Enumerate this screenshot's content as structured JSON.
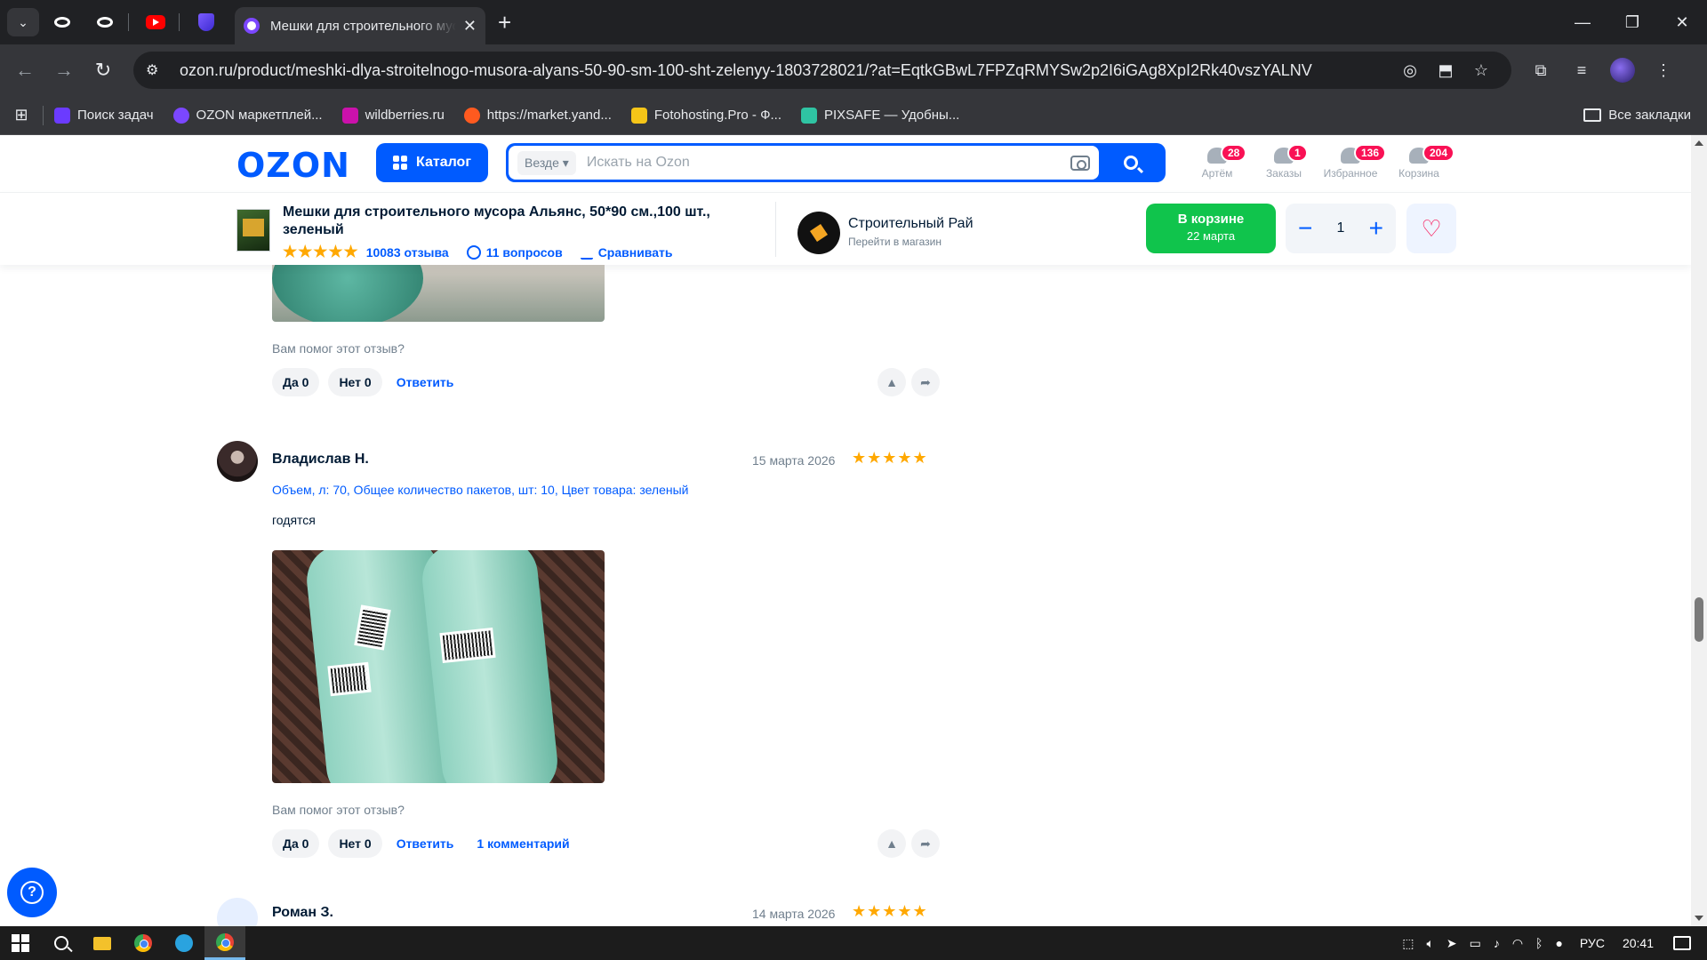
{
  "browser": {
    "tabs": {
      "menu_icon": "chevron-down-icon",
      "active_title": "Мешки для строительного мусора",
      "close_label": "✕",
      "new_tab_label": "+"
    },
    "window": {
      "minimize": "—",
      "maximize": "❐",
      "close": "✕"
    },
    "nav": {
      "back": "←",
      "forward": "→",
      "reload": "↻"
    },
    "url": "ozon.ru/product/meshki-dlya-stroitelnogo-musora-alyans-50-90-sm-100-sht-zelenyy-1803728021/?at=EqtkGBwL7FPZqRMYSw2p2I6iGAg8XpI2Rk40vszYALNV",
    "bookmarks": [
      {
        "label": "Поиск задач",
        "color": "#6b3bff"
      },
      {
        "label": "OZON маркетплей...",
        "color": "#7b47ff"
      },
      {
        "label": "wildberries.ru",
        "color": "#cb11ab"
      },
      {
        "label": "https://market.yand...",
        "color": "#ff5a1f"
      },
      {
        "label": "Fotohosting.Pro - Ф...",
        "color": "#f5c518"
      },
      {
        "label": "PIXSAFE — Удобны...",
        "color": "#2fc4a3"
      }
    ],
    "all_bookmarks": "Все закладки"
  },
  "site": {
    "logo": "OZON",
    "catalog_label": "Каталог",
    "search": {
      "scope": "Везде ▾",
      "placeholder": "Искать на Ozon"
    },
    "header_actions": [
      {
        "label": "Артём",
        "badge": "28"
      },
      {
        "label": "Заказы",
        "badge": "1"
      },
      {
        "label": "Избранное",
        "badge": "136"
      },
      {
        "label": "Корзина",
        "badge": "204"
      }
    ]
  },
  "product_bar": {
    "title": "Мешки для строительного мусора Альянс, 50*90 см.,100 шт., зеленый",
    "stars": "★★★★★",
    "reviews_count": "10083 отзыва",
    "questions_count": "11 вопросов",
    "compare_label": "Сравнивать",
    "shop_name": "Строительный Рай",
    "shop_link": "Перейти в магазин",
    "cart_label": "В корзине",
    "cart_date": "22 марта",
    "minus": "−",
    "quantity": "1",
    "plus": "+",
    "favorite_icon": "♡"
  },
  "reviews": [
    {
      "helpful_question": "Вам помог этот отзыв?",
      "yes_label": "Да 0",
      "no_label": "Нет 0",
      "reply_label": "Ответить"
    },
    {
      "author": "Владислав Н.",
      "date": "15 марта 2026",
      "stars": "★★★★★",
      "variant": "Объем, л: 70, Общее количество пакетов, шт: 10, Цвет товара: зеленый",
      "text": "годятся",
      "helpful_question": "Вам помог этот отзыв?",
      "yes_label": "Да 0",
      "no_label": "Нет 0",
      "reply_label": "Ответить",
      "comments_label": "1 комментарий"
    },
    {
      "author": "Роман З.",
      "date": "14 марта 2026",
      "stars": "★★★★★"
    }
  ],
  "help_label": "?",
  "taskbar": {
    "lang": "РУС",
    "time": "20:41"
  }
}
